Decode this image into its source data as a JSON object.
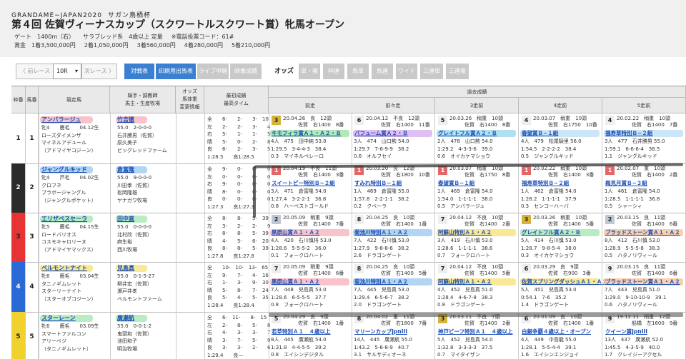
{
  "header": {
    "sub1": "GRANDAME−JAPAN2020",
    "sub2": "サガン鳥栖杯",
    "title": "第４回 佐賀ヴィーナスカップ（スクワートルスクワート賞）牝馬オープン",
    "info1": [
      "ゲート　1400m（右）",
      "サラブレッド系　4歳以上 定量",
      "※電話投票コード：61#"
    ],
    "info2": [
      "賞金　1着3,500,000円",
      "2着1,050,000円",
      "3着560,000円",
      "4着280,000円",
      "5着210,000円"
    ]
  },
  "toolbar": {
    "prev": "〈 前レース",
    "race": "10R",
    "next": "次レース 〉",
    "b1": "対戦表",
    "b2": "印刷用出馬表",
    "b3": "ライブ中継",
    "b4": "映像成績",
    "odds": "オッズ",
    "g": [
      "単・複",
      "枠連",
      "馬単",
      "馬連",
      "ワイド",
      "三連単",
      "三連複"
    ]
  },
  "head": {
    "waku": "枠番",
    "uma": "馬番",
    "horse": "競走馬",
    "jockey": "騎手・調教師\n馬主・生産牧場",
    "odds": "オッズ\n馬体重\n変更情報",
    "time": "最初成績\n最高タイム",
    "past": "過去成績",
    "cols": [
      "前走",
      "前々走",
      "3走前",
      "4走前",
      "5走前"
    ]
  },
  "entries": [
    {
      "waku": "1",
      "uma": "1",
      "name": "アンバラージュ",
      "lines": [
        "牝4　　鹿毛　　04.12生",
        "ローズダイメンザ",
        "マイネルアデュール",
        "（アドマイヤコジーン）"
      ],
      "jock": "竹吉徹",
      "jl": [
        "55.0　2-0-0-0",
        "石井勝男（佐賀）",
        "原久美子",
        "ビッグレッドファーム"
      ],
      "rec": [
        "全　　6-　　2-　　3-　10",
        "左　　2-　　2-　　3-　　4",
        "右　　5-　　1-　　1-　　5",
        "晴　　5-　　0-　　2-　　8",
        "良　　6-　　2-　　3-　　5",
        "1:28.5　　良1:28.5"
      ],
      "races": [
        {
          "rk": "3",
          "head": "20.04.26　良　12頭",
          "sub": "　　　佐賀　右1400　8番",
          "name": "キモフィラ賞Ａ１・Ａ２・Ｂ",
          "d": [
            "4人　475　田中純 53.0",
            "1:29.5　3-4-4-3　38.4",
            "0.3　マイネルペレーロ"
          ]
        },
        {
          "rk": "6",
          "head": "20.04.12　不良　12頭",
          "sub": "　　　佐賀　右1400　11番",
          "name": "バフューム賞Ａ２・Ｂ",
          "d": [
            "3人　474　山口勲 54.0",
            "1:29.7　7-6-9-9　38.2",
            "0.6　オルフセイ"
          ]
        },
        {
          "rk": "5",
          "head": "20.03.26　稍重　10頭",
          "sub": "　　　佐賀　右1400　8番",
          "name": "グレイトフル賞Ａ２・Ｂ",
          "d": [
            "2人　478　山口勲 54.0",
            "1:29.2　4-3-3-6　39.0",
            "0.6　オイカケマショウ"
          ]
        },
        {
          "rk": "4",
          "head": "20.03.07　稍重　10頭",
          "sub": "　　　佐賀　右1750　10番",
          "name": "春望賞Ｂ−１組",
          "d": [
            "4人　479　松尾騎里 56.0",
            "1:54.5　2-2-2-2　38.4",
            "0.5　ジャングルキッド"
          ]
        },
        {
          "rk": "4",
          "head": "20.02.22　稍重　10頭",
          "sub": "　　　佐賀　右1400　7番",
          "name": "福寿草特別Ｂ−２組",
          "d": [
            "3人　477　石井勝男 55.0",
            "1:59.1　6-6-6-4　38.5",
            "1.1　ジャングルキッド"
          ]
        }
      ]
    },
    {
      "waku": "2",
      "uma": "2",
      "name": "ジャングルキッド",
      "lines": [
        "牝4　　芦毛　　04.02生",
        "クロフネ",
        "ブラボージャングル",
        "（ジャングルポケット）"
      ],
      "jock": "倉富隆",
      "jl": [
        "55.0　9-0-0-0",
        "川田孝（佐賀）",
        "松岡隆雄",
        "ヤナガワ牧場"
      ],
      "rec": [
        "全　　9-　　0-　　0-　　0",
        "左　　0-　　0-　　0-　　0",
        "右　　9-　　0-　　0-　　0",
        "晴　　8-　　0-　　0-　　0",
        "良　　0-　　0-　　0-　　0",
        "1:27.3　　良1:27.3"
      ],
      "races": [
        {
          "rk": "1",
          "head": "20.04.19　不良　11頭",
          "sub": "　　　佐賀　右1400　3番",
          "name": "スイートピー特別Ｂ−２組",
          "d": [
            "3人　471　倉富隆 54.0",
            "1:27.4　3-2-2-1　36.8",
            "0.8　ハーベストゴールド"
          ]
        },
        {
          "rk": "1",
          "head": "20.03.20　良　12頭",
          "sub": "　　　佐賀　右1800　10番",
          "name": "すみれ特別Ｂ−１組",
          "d": [
            "1人　469　倉富隆 55.0",
            "1:57.8　2-2-1-1　38.2",
            "0.2　クベーラ"
          ]
        },
        {
          "rk": "1",
          "head": "20.03.07　稍重　10頭",
          "sub": "　　　佐賀　右1750　8番",
          "name": "春望賞Ｂ−１組",
          "d": [
            "1人　469　倉富隆 54.0",
            "1:54.0　1-1-1-1　38.0",
            "0.5　アンバラージュ"
          ]
        },
        {
          "rk": "1",
          "head": "20.02.22　稍重　10頭",
          "sub": "　　　佐賀　右1400　3番",
          "name": "福寿草特別Ｂ−２組",
          "d": [
            "1人　462　倉富隆 54.0",
            "1:28.2　1-1-1-1　37.9",
            "0.3　センコーハーバ"
          ]
        },
        {
          "rk": "1",
          "head": "20.02.07　重　10頭",
          "sub": "　　　佐賀　右1400　2番",
          "name": "梅見月賞Ｂ−３組",
          "d": [
            "1人　461　倉富隆 54.0",
            "1:28.5　1-1-1-1　36.8",
            "0.5　シャーシィ"
          ]
        }
      ]
    },
    {
      "waku": "3",
      "uma": "3",
      "name": "エリザベスセーラ",
      "lines": [
        "牝5　　鹿毛　　04.15生",
        "ロードバリオス",
        "コスモキャロリーヌ",
        "（アドマイヤマックス）"
      ],
      "jock": "田中直",
      "jl": [
        "55.0　0-0-0-0",
        "北村欣（佐賀）",
        "麻生裕",
        "西川牧場"
      ],
      "rec": [
        "全　　8-　　8-　　5-　39",
        "左　　3-　　2-　　2-　　9",
        "右　　8-　　8-　　5-　39",
        "晴　　4-　　5-　　6-　20",
        "良　　8-　　8-　　5-　39",
        "1:27.8　　良1:27.8"
      ],
      "races": [
        {
          "rk": "2",
          "head": "20.05.09　稍重　9頭",
          "sub": "　　　佐賀　右1400　7番",
          "name": "黒原山賞Ａ１・Ａ２",
          "d": [
            "4人　420　石川慎将 53.0",
            "1:28.6　5-5-5-2　36.0",
            "0.1　フォークロハート"
          ]
        },
        {
          "rk": "8",
          "head": "20.04.25　良　10頭",
          "sub": "　　　佐賀　右1400　1番",
          "name": "菊池川特別Ａ１・Ａ２",
          "d": [
            "7人　422　石川慎 53.0",
            "1:27.9　9-8-8-6　38.2",
            "2.6　ドラゴンゲート"
          ]
        },
        {
          "rk": "7",
          "head": "20.04.12　不良　10頭",
          "sub": "　　　佐賀　右1400　2番",
          "name": "阿蘇山特別Ａ１・Ａ２",
          "d": [
            "3人　419　石川慎 53.0",
            "1:28.6　1-1-1-1　38.6",
            "0.7　フォークロハート"
          ]
        },
        {
          "rk": "3",
          "head": "20.03.26　稍重　10頭",
          "sub": "　　　佐賀　右1400　5番",
          "name": "グレイトフル賞Ａ２・Ｂ",
          "d": [
            "5人　414　石川慎 53.0",
            "1:28.7　9-8-5-4　38.0",
            "0.3　オイカケマショウ"
          ]
        },
        {
          "rk": "2",
          "head": "20.03.15　良　11頭",
          "sub": "　　　佐賀　右1400　6番",
          "name": "ブラッドストーン賞Ａ１・Ａ２",
          "d": [
            "8人　412　石川慎 53.0",
            "1:28.9　5-5-5-8　38.3",
            "0.5　ハタノリヴィール"
          ]
        }
      ]
    },
    {
      "waku": "4",
      "uma": "4",
      "name": "ベルモントナイト",
      "lines": [
        "牝6　　鹿毛　　03.04生",
        "タニノギムレット",
        "スターリーナイト",
        "（スターオブコジーン）"
      ],
      "jock": "兒島真",
      "jl": [
        "55.0　0-1-5-27",
        "柳井宏（佐賀）",
        "瀬戸井孝",
        "ベルモントファーム"
      ],
      "rec": [
        "全　　10-　10-　13-　65",
        "左　　9-　　7-　　4-　16",
        "右　　1-　　3-　　9-　30",
        "晴　　5-　　8-　　7-　24",
        "良　　5-　　4-　　5-　35",
        "1:28.4　　良1:28.4"
      ],
      "races": [
        {
          "rk": "7",
          "head": "20.05.09　稍重　9頭",
          "sub": "　　　佐賀　右1400　6番",
          "name": "黒原山賞Ａ１・Ａ２",
          "d": [
            "7人　448　兒島真 53.0",
            "1:28.6　6-5-5-5　37.7",
            "0.8　フォークロハート"
          ]
        },
        {
          "rk": "8",
          "head": "20.04.25　良　10頭",
          "sub": "　　　佐賀　右1400　5番",
          "name": "菊池川特別Ａ１・Ａ２",
          "d": [
            "7人　445　兒島真 53.0",
            "1:29.4　6-5-6-7　38.2",
            "2.0　ドラゴンゲート"
          ]
        },
        {
          "rk": "7",
          "head": "20.04.12　不良　10頭",
          "sub": "　　　佐賀　右1400　5番",
          "name": "阿蘇山特別Ａ１・Ａ２",
          "d": [
            "4人　452　兒島真 51.0",
            "1:28.4　4-6-7-8　38.3",
            "0.8　ドラゴンゲート"
          ]
        },
        {
          "rk": "6",
          "head": "20.03.29　良　9頭",
          "sub": "　　　佐賀　右900　3番",
          "name": "佐賀スプリングダッシュＡ１・Ａ２",
          "d": [
            "5人　451　兒島真 53.0",
            "0:54.1　7-6　35.2",
            "1.4　ドラゴンゲート"
          ]
        },
        {
          "rk": "9",
          "head": "20.03.15　良　11頭",
          "sub": "　　　佐賀　右1400　6番",
          "name": "ブラッドストーン賞Ａ１・Ａ２",
          "d": [
            "7人　443　兒島真 51.0",
            "1:29.0　9-10-10-9　39.1",
            "0.6　ハタノリヴィール"
          ]
        }
      ]
    },
    {
      "waku": "5",
      "uma": "5",
      "name": "スターレーン",
      "lines": [
        "牝6　　鹿毛　　03.09生",
        "スマートファルコン",
        "アリーベジ",
        "（タニノギムレット）"
      ],
      "jock": "廣瀬航",
      "jl": [
        "55.0　0-0-1-2",
        "鬼頭和（佐賀）",
        "池田和子",
        "明治牧場"
      ],
      "rec": [
        "全　　6-　11-　　8-　15",
        "左　　2-　　8-　　5-　　8",
        "右　　4-　　3-　　3-　　7",
        "晴　　3-　　7-　　5-　　9",
        "良　　3-　　3-　　2-　　6",
        "1:29.4　　良—"
      ],
      "races": [
        {
          "rk": "5",
          "head": "20.04.29　良　9頭",
          "sub": "　　　佐賀　右1400　1番",
          "name": "若草特別Ａ１　４歳以上",
          "d": [
            "8人　445　廣瀬航 54.0",
            "1:31.8　4-4-5-5　39.2",
            "0.8　エイシンデジタル"
          ]
        },
        {
          "rk": "8",
          "head": "20.04.02　重　11頭",
          "sub": "　　　佐賀　右1800　7番",
          "name": "マリーンカップJpnIII",
          "d": [
            "14人　445　廣瀬航 55.0",
            "1:43.2　5-6-8-9　40.7",
            "3.1　サルサディオーネ"
          ]
        },
        {
          "rk": "3",
          "head": "20.03.11　不良　7頭",
          "sub": "　　　佐賀　右1400　2番",
          "name": "神戸ビーフ特別Ａ１　４歳以上",
          "d": [
            "5人　452　兒島真 54.0",
            "1:32.8　3-3-3-3　37.5",
            "0.7　マイタイザン"
          ]
        },
        {
          "rk": "6",
          "head": "20.01.09　良　10頭",
          "sub": "　　　佐賀　右1400　1番",
          "name": "白銀争覇４歳以上・オープン",
          "d": [
            "4人　449　中島龍 55.0",
            "1:28.1　5-5-4-4　39.1",
            "1.6　エイシンエンジョイ"
          ]
        },
        {
          "rk": "9",
          "head": "19.12.11　稍重　12頭",
          "sub": "　　　船橋　左1600　9番",
          "name": "クイーン賞JpnIII",
          "d": [
            "13人　437　廣瀬航 52.0",
            "1:45.5　4-3-5-9　40.0",
            "1.7　クレイジーアクセル"
          ]
        }
      ]
    }
  ],
  "colors": {
    "waku": [
      "#ffffff",
      "#2b2b2b",
      "#e63333",
      "#2a6ad6",
      "#f0d22e"
    ],
    "rank1": "#e26868",
    "rank2": "#bfc6d4",
    "rank3": "#d6b43a",
    "rankn": "#eeeeee"
  }
}
